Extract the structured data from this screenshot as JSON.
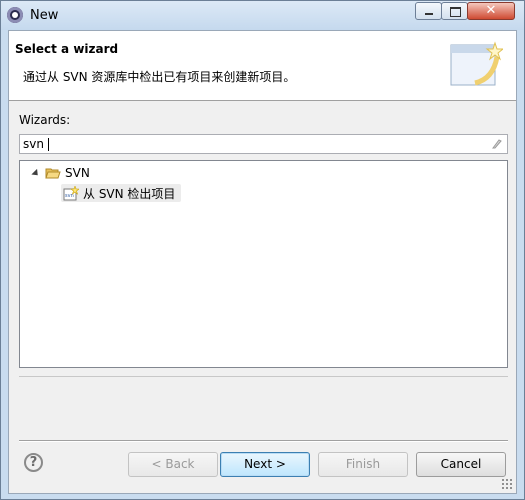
{
  "window": {
    "title": "New"
  },
  "header": {
    "title": "Select a wizard",
    "description": "通过从 SVN 资源库中检出已有项目来创建新项目。"
  },
  "filter": {
    "label": "Wizards:",
    "value": "svn"
  },
  "tree": {
    "nodes": [
      {
        "label": "SVN",
        "icon": "folder-open-icon",
        "expanded": true,
        "children": [
          {
            "label": "从 SVN 检出项目",
            "icon": "svn-checkout-icon",
            "selected": true
          }
        ]
      }
    ]
  },
  "buttons": {
    "back": "< Back",
    "next": "Next >",
    "finish": "Finish",
    "cancel": "Cancel"
  },
  "colors": {
    "default_button": "#bee6fd",
    "title_bar": "#c5d9ee"
  }
}
